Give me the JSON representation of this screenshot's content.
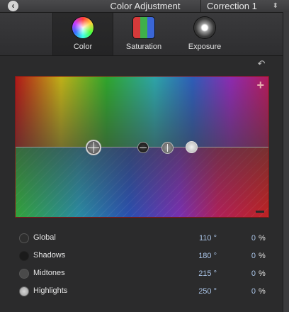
{
  "header": {
    "title": "Color Adjustment",
    "correction": "Correction 1"
  },
  "tabs": [
    {
      "label": "Color",
      "icon": "color-wheel-icon",
      "active": true
    },
    {
      "label": "Saturation",
      "icon": "saturation-swatch-icon",
      "active": false
    },
    {
      "label": "Exposure",
      "icon": "exposure-icon",
      "active": false
    }
  ],
  "board": {
    "plus_symbol": "+",
    "undo_symbol": "↶"
  },
  "rows": [
    {
      "name": "Global",
      "angle": "110 °",
      "percent": "0",
      "percent_symbol": "%"
    },
    {
      "name": "Shadows",
      "angle": "180 °",
      "percent": "0",
      "percent_symbol": "%"
    },
    {
      "name": "Midtones",
      "angle": "215 °",
      "percent": "0",
      "percent_symbol": "%"
    },
    {
      "name": "Highlights",
      "angle": "250 °",
      "percent": "0",
      "percent_symbol": "%"
    }
  ],
  "colors": {
    "background": "#2b2b2c",
    "value_text": "#a9c3e6"
  }
}
